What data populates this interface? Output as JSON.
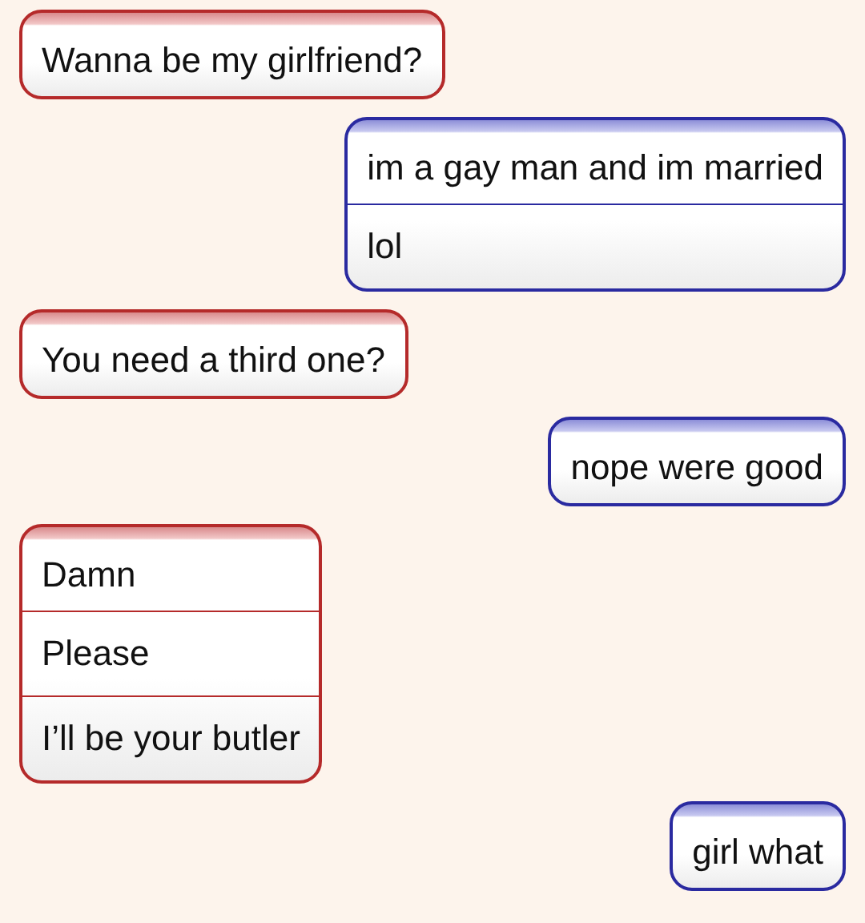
{
  "messages": [
    {
      "kind": "received",
      "lines": [
        "Wanna be my girlfriend?"
      ]
    },
    {
      "kind": "sent",
      "lines": [
        "im a gay man and im married",
        "lol"
      ]
    },
    {
      "kind": "received",
      "lines": [
        "You need a third one?"
      ]
    },
    {
      "kind": "sent",
      "lines": [
        "nope were good"
      ]
    },
    {
      "kind": "received",
      "lines": [
        "Damn",
        "Please",
        "I’ll be your butler"
      ]
    },
    {
      "kind": "sent",
      "lines": [
        "girl what"
      ]
    }
  ]
}
